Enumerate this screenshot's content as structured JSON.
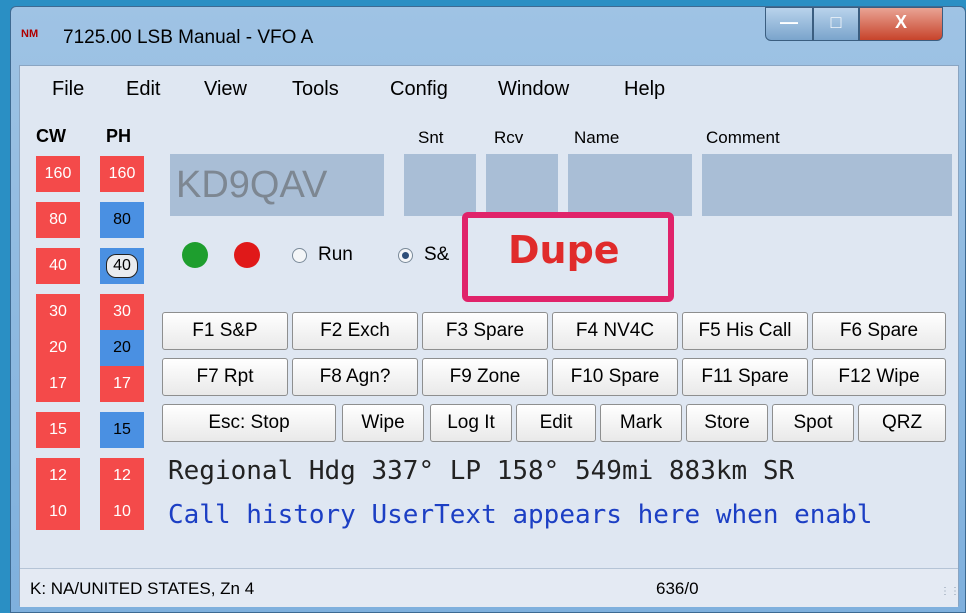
{
  "window": {
    "title": "7125.00 LSB Manual - VFO A",
    "app_icon_text": "NM"
  },
  "menu": [
    "File",
    "Edit",
    "View",
    "Tools",
    "Config",
    "Window",
    "Help"
  ],
  "columns": {
    "cw": "CW",
    "ph": "PH",
    "snt": "Snt",
    "rcv": "Rcv",
    "name": "Name",
    "comment": "Comment"
  },
  "bands": {
    "cw": [
      {
        "label": "160",
        "color": "red"
      },
      {
        "label": "80",
        "color": "red"
      },
      {
        "label": "40",
        "color": "red"
      },
      {
        "label": "30",
        "color": "red"
      },
      {
        "label": "20",
        "color": "red"
      },
      {
        "label": "17",
        "color": "red"
      },
      {
        "label": "15",
        "color": "red"
      },
      {
        "label": "12",
        "color": "red"
      },
      {
        "label": "10",
        "color": "red"
      }
    ],
    "ph": [
      {
        "label": "160",
        "color": "red"
      },
      {
        "label": "80",
        "color": "blue"
      },
      {
        "label": "40",
        "color": "selected"
      },
      {
        "label": "30",
        "color": "red"
      },
      {
        "label": "20",
        "color": "blue"
      },
      {
        "label": "17",
        "color": "red"
      },
      {
        "label": "15",
        "color": "blue"
      },
      {
        "label": "12",
        "color": "red"
      },
      {
        "label": "10",
        "color": "red"
      }
    ]
  },
  "entry": {
    "call": "KD9QAV",
    "snt": "",
    "rcv": "",
    "name": "",
    "comment": ""
  },
  "indicators": {
    "green": "#1e9e2e",
    "red": "#e01919"
  },
  "mode": {
    "run_label": "Run",
    "sp_label": "S&",
    "selected": "S&P"
  },
  "dupe": {
    "label": "Dupe",
    "border_color": "#e0236a",
    "text_color": "#e02b2b"
  },
  "fkeys": {
    "row1": [
      "F1 S&P",
      "F2 Exch",
      "F3 Spare",
      "F4 NV4C",
      "F5 His Call",
      "F6 Spare"
    ],
    "row2": [
      "F7 Rpt",
      "F8 Agn?",
      "F9 Zone",
      "F10 Spare",
      "F11 Spare",
      "F12 Wipe"
    ],
    "row3": [
      "Esc: Stop",
      "Wipe",
      "Log It",
      "Edit",
      "Mark",
      "Store",
      "Spot",
      "QRZ"
    ]
  },
  "info": {
    "heading": "Regional Hdg 337° LP 158° 549mi 883km SR",
    "call_history": "Call history UserText appears here when enabl"
  },
  "status": {
    "left": "K: NA/UNITED STATES, Zn 4",
    "count": "636/0"
  }
}
